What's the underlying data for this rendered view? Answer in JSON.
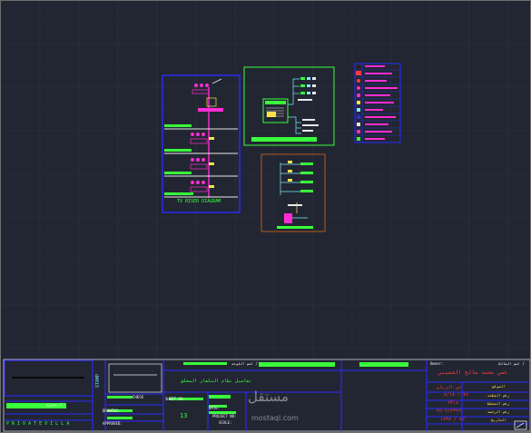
{
  "colors": {
    "background": "#222632",
    "grid": "#2c3140",
    "blue": "#2b2bff",
    "green": "#39ff3c",
    "magenta": "#ff2bd6",
    "red": "#ff3b3b",
    "yellow": "#ffe24a",
    "orange": "#b35a1c",
    "white": "#f2f2f2",
    "cyan": "#7fe9ff"
  },
  "drawings": {
    "riser_title": "TV RISER DIAGRAM"
  },
  "title_block": {
    "project_ar": "مشروع /",
    "brand_en": "P R I V A T E   V I L L A",
    "side_label": "STAMP",
    "drawing_label": "DRAWING:",
    "approved_label": "APPROVED:",
    "scale_label": "SCALE:",
    "check_label": "CHECK",
    "date_label": "DATE:",
    "project_no_label": "PROJECT NO:",
    "sheet_no_label": "SHEET NO:",
    "sheet_number": "13",
    "dwg_title_ar": "تفاصيل نظام التلفاز المغلق",
    "dwg_label_ar": "اسم اللوحة /",
    "owner_label": "Owner:",
    "owner_label_ar": "اسم المالك /",
    "owner_name_ar": "حسن محمد صالح الحسيني",
    "district_label_ar": "حي الريان",
    "row_labels_ar": [
      "الموقع",
      "رقم القطعة",
      "رقم المخطط",
      "رقم الرخصة",
      "التاريخ"
    ],
    "row_values": [
      "٧٤ / ٨/١٨",
      "٢٣١٨",
      "٢٥٠٢/٢٣٢٢",
      "٨ / ١٤٣٨/"
    ]
  },
  "watermark": {
    "text_ar": "مستقل",
    "domain": "mostaql.com"
  }
}
